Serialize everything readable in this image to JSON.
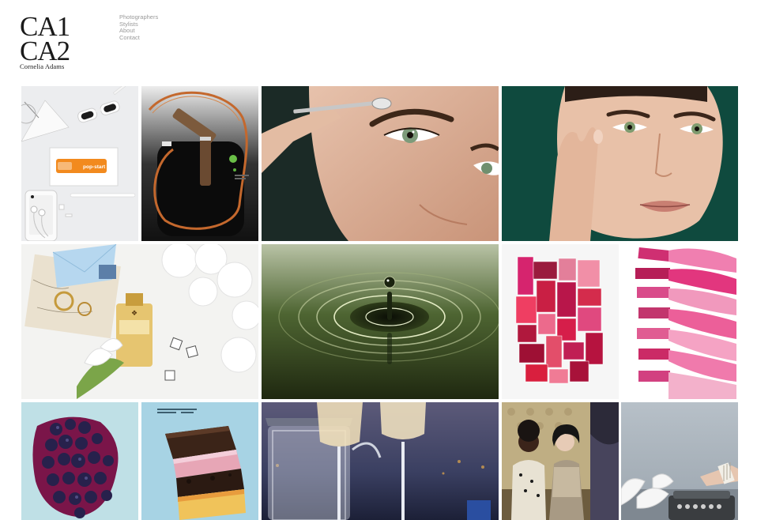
{
  "logo": {
    "line1": "CA1",
    "line2": "CA2",
    "name": "Cornelia Adams"
  },
  "nav": [
    "Photographers",
    "Stylists",
    "About",
    "Contact"
  ],
  "gallery": [
    {
      "name": "tile-office-flatlay",
      "text": "pop-start"
    },
    {
      "name": "tile-jump-rope"
    },
    {
      "name": "tile-eye-beauty"
    },
    {
      "name": "tile-face-beauty"
    },
    {
      "name": "tile-perfume-still-life"
    },
    {
      "name": "tile-water-droplet"
    },
    {
      "name": "tile-lipstick-blocks"
    },
    {
      "name": "tile-crushed-lipstick"
    },
    {
      "name": "tile-blueberries"
    },
    {
      "name": "tile-layered-cake"
    },
    {
      "name": "tile-champagne-glasses"
    },
    {
      "name": "tile-fashion-friends"
    },
    {
      "name": "tile-typewriter"
    }
  ]
}
